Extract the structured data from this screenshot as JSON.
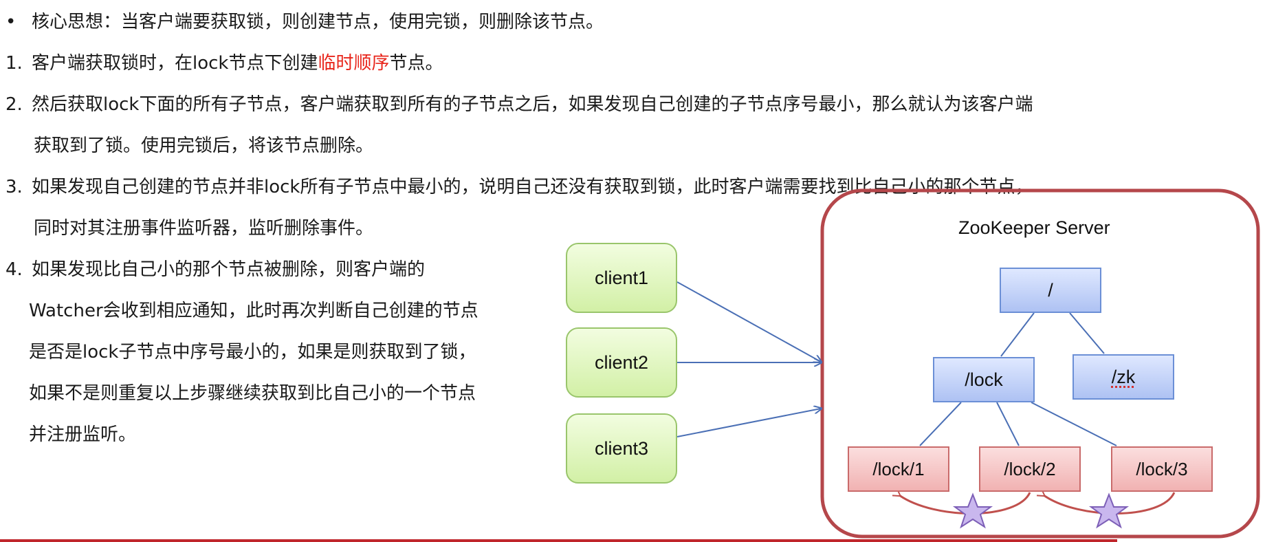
{
  "text_lines": [
    {
      "marker": "•",
      "text": "核心思想：当客户端要获取锁，则创建节点，使用完锁，则删除该节点。"
    },
    {
      "marker": "1.",
      "before": "客户端获取锁时，在lock节点下创建",
      "highlight": "临时顺序",
      "after": "节点。"
    },
    {
      "marker": "2.",
      "text": "然后获取lock下面的所有子节点，客户端获取到所有的子节点之后，如果发现自己创建的子节点序号最小，那么就认为该客户端"
    },
    {
      "text": "获取到了锁。使用完锁后，将该节点删除。"
    },
    {
      "marker": "3.",
      "text": "如果发现自己创建的节点并非lock所有子节点中最小的，说明自己还没有获取到锁，此时客户端需要找到比自己小的那个节点，"
    },
    {
      "text": "同时对其注册事件监听器，监听删除事件。"
    },
    {
      "marker": "4.",
      "text": "如果发现比自己小的那个节点被删除，则客户端的"
    },
    {
      "text": "Watcher会收到相应通知，此时再次判断自己创建的节点"
    },
    {
      "text": "是否是lock子节点中序号最小的，如果是则获取到了锁，"
    },
    {
      "text": "如果不是则重复以上步骤继续获取到比自己小的一个节点"
    },
    {
      "text": "并注册监听。"
    }
  ],
  "diagram": {
    "server_title": "ZooKeeper Server",
    "clients": [
      "client1",
      "client2",
      "client3"
    ],
    "nodes": {
      "root": "/",
      "lock": "/lock",
      "zk": "/zk",
      "lock1": "/lock/1",
      "lock2": "/lock/2",
      "lock3": "/lock/3"
    },
    "watcher_icon": "star-icon"
  },
  "colors": {
    "highlight": "#e8251b",
    "server_border": "#b5474b",
    "client_border": "#99c56b",
    "blue_node": "#aec2f3",
    "red_node": "#f1b2b2",
    "connector": "#4a6fb5",
    "star_fill": "#c9b7ee"
  }
}
